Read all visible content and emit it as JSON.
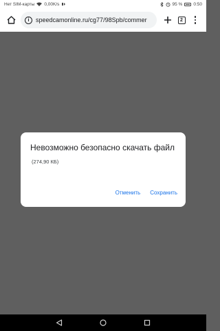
{
  "status_bar": {
    "carrier": "Нет SIM-карты",
    "network_speed": "0,00K/s",
    "battery_percent": "95 %",
    "time": "0:50"
  },
  "toolbar": {
    "url": "speedcamonline.ru/cg77/98Spb/commer",
    "tab_count": "2"
  },
  "dialog": {
    "title": "Невозможно безопасно скачать файл",
    "file_size": "(274,90 КБ)",
    "cancel_label": "Отменить",
    "save_label": "Сохранить"
  },
  "colors": {
    "scrim": "#5f5f5f",
    "accent": "#1a73e8",
    "nav_bar": "#000000"
  }
}
